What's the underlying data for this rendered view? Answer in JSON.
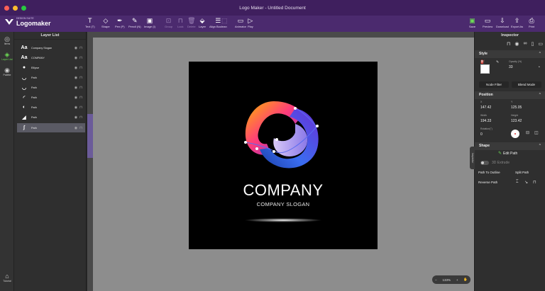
{
  "window": {
    "title": "Logo Maker - Untitled Document"
  },
  "logo": {
    "small": "DESIGN SUITE",
    "big": "Logomaker"
  },
  "toolbar": {
    "tools": [
      {
        "label": "Text (T)",
        "icon": "T"
      },
      {
        "label": "Shape",
        "icon": "◇"
      },
      {
        "label": "Pen (P)",
        "icon": "✒"
      },
      {
        "label": "Pencil (N)",
        "icon": "✎"
      },
      {
        "label": "Image (I)",
        "icon": "▣"
      },
      {
        "label": "Group",
        "icon": "⊡"
      },
      {
        "label": "Lock",
        "icon": "⊓"
      },
      {
        "label": "Delete",
        "icon": "🗑"
      },
      {
        "label": "Layer",
        "icon": "⬙"
      },
      {
        "label": "Align Boolean",
        "icon": "☰"
      },
      {
        "label": "",
        "icon": "⬚"
      },
      {
        "label": "Animator",
        "icon": "▭"
      },
      {
        "label": "Play",
        "icon": "▷"
      }
    ],
    "right_tools": [
      {
        "label": "Save",
        "icon": "▣"
      },
      {
        "label": "Preview",
        "icon": "▭"
      },
      {
        "label": "Download",
        "icon": "⇩"
      },
      {
        "label": "Export As",
        "icon": "⇪"
      },
      {
        "label": "Print",
        "icon": "⎙"
      }
    ]
  },
  "rail": {
    "items": [
      {
        "label": "Items",
        "icon": "◎"
      },
      {
        "label": "Layer List",
        "icon": "◈"
      },
      {
        "label": "Palette",
        "icon": "◉"
      },
      {
        "label": "Tutorial",
        "icon": "⌂"
      }
    ]
  },
  "layer_list": {
    "title": "Layer List",
    "layers": [
      {
        "name": "Company Slogan",
        "thumb": "Aa"
      },
      {
        "name": "COMPANY",
        "thumb": "Aa"
      },
      {
        "name": "Ellipse",
        "thumb": "●"
      },
      {
        "name": "Path",
        "thumb": "◡"
      },
      {
        "name": "Path",
        "thumb": "◡"
      },
      {
        "name": "Path",
        "thumb": "◜"
      },
      {
        "name": "Path",
        "thumb": "◐"
      },
      {
        "name": "Path",
        "thumb": "◢"
      },
      {
        "name": "Path",
        "thumb": "∫"
      }
    ],
    "selected_index": 8
  },
  "canvas": {
    "company_text": "COMPANY",
    "slogan_text": "COMPANY SLOGAN",
    "zoom": "133%"
  },
  "inspector": {
    "title": "Inspector",
    "style": {
      "title": "Style",
      "opacity_label": "Opacity (%)",
      "opacity": "33",
      "node_filter": "Node Filter",
      "blend_mode": "Blend Mode"
    },
    "position": {
      "title": "Position",
      "x_label": "X",
      "x": "147.42",
      "y_label": "Y",
      "y": "125.05",
      "w_label": "Width",
      "w": "194.33",
      "h_label": "Height",
      "h": "123.42",
      "rot_label": "Rotation(°)",
      "rot": "0"
    },
    "shape": {
      "title": "Shape",
      "edit_path": "Edit Path",
      "extrude": "3D Extrude",
      "path_to_outline": "Path To Outline",
      "split_path": "Split Path",
      "reverse_path": "Reverse Path"
    },
    "side_tab": "Inspector"
  },
  "colors": {
    "title_bar": "#3f1f5e",
    "toolbar": "#4b2a6e",
    "active": "#6ddc55"
  }
}
